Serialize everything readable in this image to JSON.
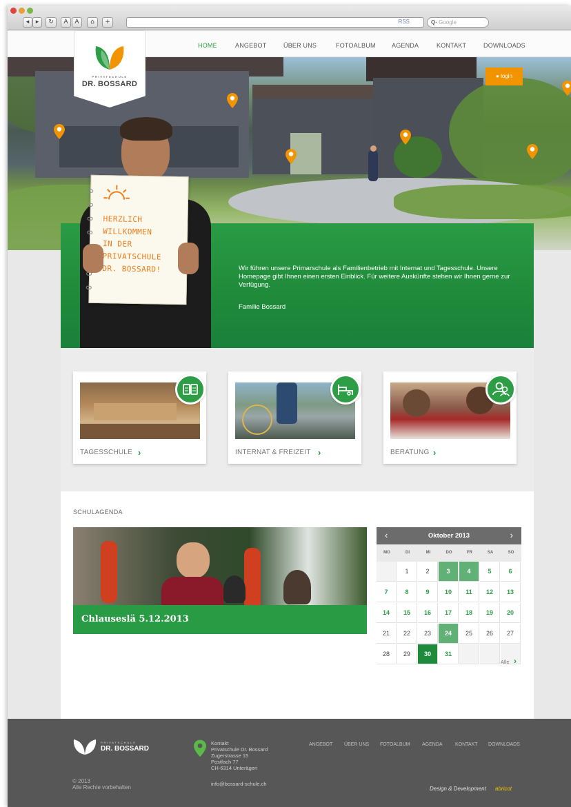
{
  "browser": {
    "nav_buttons": [
      "◂",
      "▸",
      "↻",
      "A",
      "A",
      "⌂",
      "+"
    ],
    "rss_label": "RSS",
    "search_placeholder": "Google"
  },
  "nav": {
    "items": [
      "HOME",
      "ANGEBOT",
      "ÜBER UNS",
      "FOTOALBUM",
      "AGENDA",
      "KONTAKT",
      "DOWNLOADS"
    ],
    "active": "HOME"
  },
  "logo": {
    "small": "PRIVATSCHULE",
    "big": "DR. BOSSARD",
    "icon": "leaves-icon"
  },
  "login": {
    "label": "login",
    "icon": "lock-icon"
  },
  "notebook": {
    "lines": [
      "HERZLICH",
      "WILLKOMMEN",
      "IN DER",
      "PRIVATSCHULE",
      "DR. BOSSARD!"
    ]
  },
  "welcome": {
    "text": "Wir führen unsere Primarschule als Familienbetrieb mit Internat und Tagesschule. Unsere Homepage gibt Ihnen einen ersten Einblick. Für weitere Auskünfte stehen wir Ihnen gerne zur Verfügung.",
    "signature": "Familie Bossard"
  },
  "features": [
    {
      "label": "TAGESSCHULE",
      "icon": "book-icon"
    },
    {
      "label": "INTERNAT & FREIZEIT",
      "icon": "bed-icon"
    },
    {
      "label": "BERATUNG",
      "icon": "people-icon"
    }
  ],
  "agenda": {
    "title": "SCHULAGENDA",
    "event_title": "Chlauseslä 5.12.2013",
    "all_label": "Alle"
  },
  "calendar": {
    "month": "Oktober 2013",
    "weekdays": [
      "MO",
      "DI",
      "MI",
      "DO",
      "FR",
      "SA",
      "SO"
    ],
    "weeks": [
      [
        "",
        "1",
        "2",
        "3",
        "4",
        "5",
        "6"
      ],
      [
        "7",
        "8",
        "9",
        "10",
        "11",
        "12",
        "13"
      ],
      [
        "14",
        "15",
        "16",
        "17",
        "18",
        "19",
        "20"
      ],
      [
        "21",
        "22",
        "23",
        "24",
        "25",
        "26",
        "27"
      ],
      [
        "28",
        "29",
        "30",
        "31",
        "",
        "",
        ""
      ]
    ],
    "event_days": [
      "3",
      "4",
      "5",
      "6",
      "7",
      "8",
      "9",
      "10",
      "11",
      "12",
      "13",
      "14",
      "15",
      "16",
      "17",
      "18",
      "19",
      "20",
      "24",
      "30",
      "31"
    ],
    "highlight_days": [
      "3",
      "4",
      "24"
    ],
    "selected_day": "30"
  },
  "footer": {
    "logo_small": "PRIVATSCHULE",
    "logo_big": "DR. BOSSARD",
    "copyright": "© 2013",
    "rights": "Alle Rechte vorbehalten",
    "contact_title": "Kontakt",
    "address": [
      "Privatschule Dr. Bossard",
      "Zugerstrasse 15",
      "Postfach 77",
      "CH-6314 Unterägeri"
    ],
    "email": "info@bossard-schule.ch",
    "links": [
      "ANGEBOT",
      "ÜBER UNS",
      "FOTOALBUM",
      "AGENDA",
      "KONTAKT",
      "DOWNLOADS"
    ],
    "credit": "Design & Development",
    "credit_brand": "abricot"
  },
  "colors": {
    "green": "#2d9e46",
    "orange": "#f29400",
    "footer": "#575757"
  }
}
